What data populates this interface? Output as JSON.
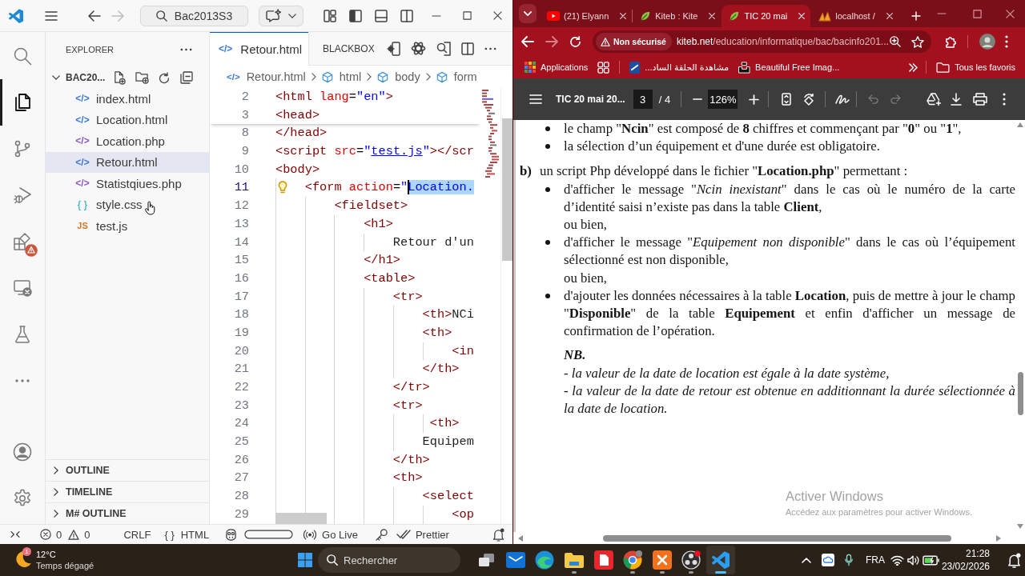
{
  "vscode": {
    "title_bar": {
      "nav": [
        {
          "kind": "back",
          "disabled": false
        },
        {
          "kind": "forward",
          "disabled": true
        }
      ],
      "command_center": "Bac2013S3"
    },
    "activity_bar": {
      "top": [
        {
          "kind": "search",
          "selected": false,
          "warning": false
        },
        {
          "kind": "explorer",
          "selected": true,
          "warning": false
        },
        {
          "kind": "source-control",
          "selected": false,
          "warning": false
        },
        {
          "kind": "run-debug",
          "selected": false,
          "warning": false
        },
        {
          "kind": "extensions",
          "selected": false,
          "warning": true
        },
        {
          "kind": "remote",
          "selected": false,
          "warning": false
        },
        {
          "kind": "testing",
          "selected": false,
          "warning": false
        },
        {
          "kind": "more",
          "selected": false,
          "warning": false
        }
      ],
      "bottom": [
        {
          "kind": "account"
        },
        {
          "kind": "settings"
        }
      ]
    },
    "explorer": {
      "title": "EXPLORER",
      "folder": {
        "name": "BAC20...",
        "expanded": true
      },
      "files": [
        {
          "name": "index.html",
          "kind": "html",
          "icon": "</>",
          "selected": false
        },
        {
          "name": "Location.html",
          "kind": "html",
          "icon": "</>",
          "selected": false
        },
        {
          "name": "Location.php",
          "kind": "php",
          "icon": "</>",
          "selected": false
        },
        {
          "name": "Retour.html",
          "kind": "html",
          "icon": "</>",
          "selected": true
        },
        {
          "name": "Statistqiues.php",
          "kind": "php",
          "icon": "</>",
          "selected": false
        },
        {
          "name": "style.css",
          "kind": "css",
          "icon": "{ }",
          "selected": false
        },
        {
          "name": "test.js",
          "kind": "js",
          "icon": "JS",
          "selected": false
        }
      ],
      "sections": [
        {
          "title": "OUTLINE",
          "expanded": false
        },
        {
          "title": "TIMELINE",
          "expanded": false
        },
        {
          "title": "M# OUTLINE",
          "expanded": false
        }
      ]
    },
    "editor": {
      "tabs": [
        {
          "icon": "</>",
          "label": "Retour.html",
          "selected": true
        }
      ],
      "view_title": "BLACKBOX",
      "breadcrumbs": [
        {
          "kind": "file",
          "icon": "</>",
          "label": "Retour.html"
        },
        {
          "kind": "element",
          "label": "html"
        },
        {
          "kind": "element",
          "label": "body"
        },
        {
          "kind": "element",
          "label": "form"
        }
      ],
      "sticky_lines": [
        {
          "number": "2",
          "current": false,
          "lightbulb": false,
          "tokens": [
            {
              "kind": "tag",
              "text": "<html"
            },
            {
              "kind": "attr",
              "text": " lang"
            },
            {
              "kind": "punct",
              "text": "="
            },
            {
              "kind": "string",
              "text": "\"en\""
            },
            {
              "kind": "tag",
              "text": ">"
            }
          ]
        },
        {
          "number": "3",
          "current": false,
          "lightbulb": false,
          "tokens": [
            {
              "kind": "tag",
              "text": "<head>"
            }
          ]
        }
      ],
      "lines": [
        {
          "number": "8",
          "current": false,
          "lightbulb": false,
          "tokens": [
            {
              "kind": "tag",
              "text": "</head>"
            }
          ]
        },
        {
          "number": "9",
          "current": false,
          "lightbulb": false,
          "tokens": [
            {
              "kind": "tag",
              "text": "<script"
            },
            {
              "kind": "attr",
              "text": " src"
            },
            {
              "kind": "punct",
              "text": "="
            },
            {
              "kind": "string",
              "text": "\""
            },
            {
              "kind": "link",
              "text": "test.js"
            },
            {
              "kind": "string",
              "text": "\""
            },
            {
              "kind": "tag",
              "text": "></scr"
            }
          ]
        },
        {
          "number": "10",
          "current": false,
          "lightbulb": false,
          "tokens": [
            {
              "kind": "tag",
              "text": "<body>"
            }
          ]
        },
        {
          "number": "11",
          "current": true,
          "lightbulb": true,
          "tokens": [
            {
              "kind": "tag",
              "text": "    <form"
            },
            {
              "kind": "attr",
              "text": " action"
            },
            {
              "kind": "punct",
              "text": "="
            },
            {
              "kind": "string",
              "text": "\""
            },
            {
              "kind": "selection",
              "text": "Location."
            }
          ]
        },
        {
          "number": "12",
          "current": false,
          "lightbulb": false,
          "tokens": [
            {
              "kind": "tag",
              "text": "        <fieldset>"
            }
          ]
        },
        {
          "number": "13",
          "current": false,
          "lightbulb": false,
          "tokens": [
            {
              "kind": "tag",
              "text": "            <h1>"
            }
          ]
        },
        {
          "number": "14",
          "current": false,
          "lightbulb": false,
          "tokens": [
            {
              "kind": "text",
              "text": "                Retour d'un"
            }
          ]
        },
        {
          "number": "15",
          "current": false,
          "lightbulb": false,
          "tokens": [
            {
              "kind": "tag",
              "text": "            </h1>"
            }
          ]
        },
        {
          "number": "16",
          "current": false,
          "lightbulb": false,
          "tokens": [
            {
              "kind": "tag",
              "text": "            <table>"
            }
          ]
        },
        {
          "number": "17",
          "current": false,
          "lightbulb": false,
          "tokens": [
            {
              "kind": "tag",
              "text": "                <tr>"
            }
          ]
        },
        {
          "number": "18",
          "current": false,
          "lightbulb": false,
          "tokens": [
            {
              "kind": "tag",
              "text": "                    <th>"
            },
            {
              "kind": "text",
              "text": "NCi"
            }
          ]
        },
        {
          "number": "19",
          "current": false,
          "lightbulb": false,
          "tokens": [
            {
              "kind": "tag",
              "text": "                    <th>"
            }
          ]
        },
        {
          "number": "20",
          "current": false,
          "lightbulb": false,
          "tokens": [
            {
              "kind": "tag",
              "text": "                        <in"
            }
          ]
        },
        {
          "number": "21",
          "current": false,
          "lightbulb": false,
          "tokens": [
            {
              "kind": "tag",
              "text": "                    </th>"
            }
          ]
        },
        {
          "number": "22",
          "current": false,
          "lightbulb": false,
          "tokens": [
            {
              "kind": "tag",
              "text": "                </tr>"
            }
          ]
        },
        {
          "number": "23",
          "current": false,
          "lightbulb": false,
          "tokens": [
            {
              "kind": "tag",
              "text": "                <tr>"
            }
          ]
        },
        {
          "number": "24",
          "current": false,
          "lightbulb": false,
          "tokens": [
            {
              "kind": "tag",
              "text": "                     <th>"
            }
          ]
        },
        {
          "number": "25",
          "current": false,
          "lightbulb": false,
          "tokens": [
            {
              "kind": "text",
              "text": "                    Equipem"
            }
          ]
        },
        {
          "number": "26",
          "current": false,
          "lightbulb": false,
          "tokens": [
            {
              "kind": "tag",
              "text": "                </th>"
            }
          ]
        },
        {
          "number": "27",
          "current": false,
          "lightbulb": false,
          "tokens": [
            {
              "kind": "tag",
              "text": "                <th>"
            }
          ]
        },
        {
          "number": "28",
          "current": false,
          "lightbulb": false,
          "tokens": [
            {
              "kind": "tag",
              "text": "                    <select"
            }
          ]
        },
        {
          "number": "29",
          "current": false,
          "lightbulb": false,
          "tokens": [
            {
              "kind": "tag",
              "text": "                        <op"
            }
          ]
        }
      ]
    },
    "status_bar": {
      "errors": "0",
      "warnings": "0",
      "eol": "CRLF",
      "language_icon": "{ }",
      "language": "HTML",
      "live_server": "Go Live",
      "formatter": "Prettier"
    }
  },
  "browser": {
    "tabs": [
      {
        "kind": "video",
        "title": "(21) Elyann",
        "selected": false
      },
      {
        "kind": "site",
        "title": "Kiteb : Kite",
        "selected": false
      },
      {
        "kind": "site",
        "title": "TIC 20 mai",
        "selected": true
      },
      {
        "kind": "server",
        "title": "localhost /",
        "selected": false
      }
    ],
    "toolbar": {
      "nav": [
        {
          "kind": "back",
          "disabled": false
        },
        {
          "kind": "forward",
          "disabled": true
        },
        {
          "kind": "reload",
          "disabled": false
        }
      ],
      "security": "Non sécurisé",
      "url_host": "kiteb.net",
      "url_path": "/education/informatique/bac/bacinfo201..."
    },
    "bookmarks": [
      {
        "kind": "apps",
        "label": "Applications"
      },
      {
        "kind": "groups"
      },
      {
        "kind": "site",
        "label": "مشاهدة الحلقة الساد..."
      },
      {
        "kind": "images",
        "label": "Beautiful Free Imag..."
      }
    ],
    "other_bookmarks": "Tous les favoris",
    "pdf": {
      "toolbar": {
        "title": "TIC 20 mai 20...",
        "page": "3",
        "page_total": "/ 4",
        "zoom": "126%",
        "history": [
          {
            "kind": "undo",
            "disabled": true
          },
          {
            "kind": "redo",
            "disabled": true
          }
        ]
      },
      "blocks": [
        {
          "kind": "bullet",
          "text": "le champ \"**Ncin**\" est composé de **8** chiffres et commençant par \"**0**\" ou \"**1**\","
        },
        {
          "kind": "bullet",
          "text": "la sélection d’un équipement et d'une durée est obligatoire."
        },
        {
          "kind": "item",
          "marker": "b)",
          "text": "un script Php développé dans le fichier \"**Location.php**\" permettant :"
        },
        {
          "kind": "bullet",
          "text": "d'afficher le message \"*Ncin inexistant*\" dans le cas où le numéro de la carte d’identité saisi n’existe pas dans la table **Client**,"
        },
        {
          "kind": "plain",
          "text": "ou bien,"
        },
        {
          "kind": "bullet",
          "text": "d'afficher le message \"*Equipement non disponible*\" dans le cas où l’équipement sélectionné est non disponible,"
        },
        {
          "kind": "plain",
          "text": "ou bien,"
        },
        {
          "kind": "bullet",
          "text": "d'ajouter les données nécessaires à la table **Location**, puis de mettre à jour le champ \"**Disponible**\" de la table **Equipement** et enfin d'afficher un message de confirmation de l’opération."
        },
        {
          "kind": "note_title",
          "text": "NB."
        },
        {
          "kind": "note",
          "text": "- la valeur de la date de location est égale à la date système,"
        },
        {
          "kind": "note",
          "text": "- la valeur de la date de retour est obtenue en additionnant la durée sélectionnée à la date de location."
        }
      ]
    },
    "activation_notice": {
      "title": "Activer Windows",
      "hint": "Accédez aux paramètres pour activer Windows."
    }
  },
  "taskbar": {
    "weather": {
      "badge": "1",
      "temperature": "12°C",
      "condition": "Temps dégagé"
    },
    "search": {
      "placeholder": "Rechercher"
    },
    "apps": [
      {
        "kind": "mail",
        "running": false,
        "selected": false,
        "alert": false
      },
      {
        "kind": "edge",
        "running": false,
        "selected": false,
        "alert": false
      },
      {
        "kind": "files",
        "running": true,
        "selected": false,
        "alert": false
      },
      {
        "kind": "wps",
        "running": false,
        "selected": false,
        "alert": false
      },
      {
        "kind": "chrome",
        "running": true,
        "selected": false,
        "alert": false
      },
      {
        "kind": "xampp",
        "running": true,
        "selected": false,
        "alert": false
      },
      {
        "kind": "obs",
        "running": true,
        "selected": false,
        "alert": true
      },
      {
        "kind": "vscode",
        "running": true,
        "selected": true,
        "alert": false
      }
    ],
    "tray": {
      "language": "FRA",
      "time": "21:28",
      "date": "23/02/2026"
    }
  }
}
